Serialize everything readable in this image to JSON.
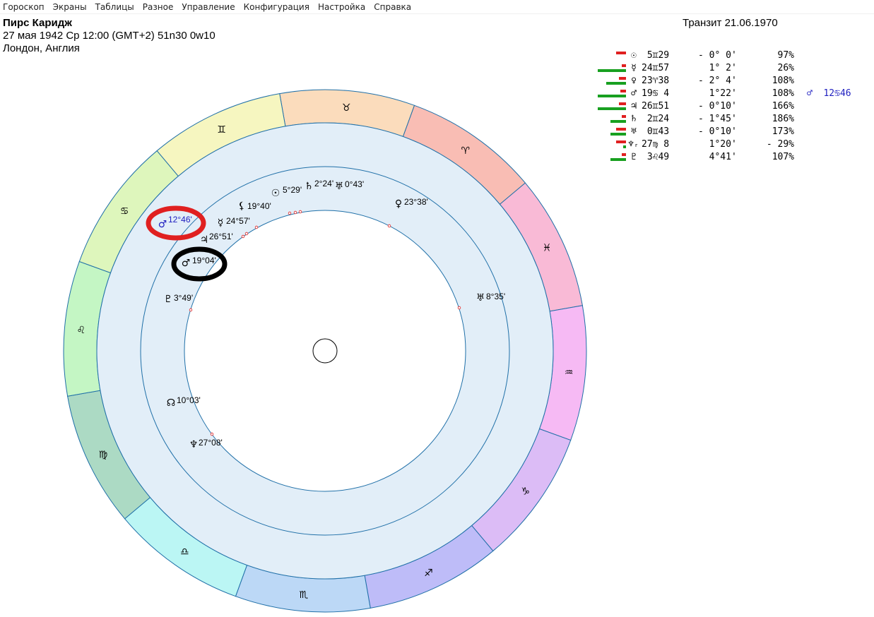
{
  "menu": [
    "Гороскоп",
    "Экраны",
    "Таблицы",
    "Разное",
    "Управление",
    "Конфигурация",
    "Настройка",
    "Справка"
  ],
  "header": {
    "name": "Пирс Каридж",
    "date_line": "27 мая 1942  Ср  12:00 (GMT+2) 51n30  0w10",
    "place": "Лондон, Англия"
  },
  "transit_title": "Транзит 21.06.1970",
  "planet_table": [
    {
      "glyph": "☉",
      "pos": " 5♊29",
      "aspect": "- 0° 0'",
      "pct": "97%",
      "red": 14,
      "green": 0,
      "extra": ""
    },
    {
      "glyph": "☿",
      "pos": "24♊57",
      "aspect": "  1° 2'",
      "pct": "26%",
      "red": 6,
      "green": 40,
      "extra": ""
    },
    {
      "glyph": "♀",
      "pos": "23♈38",
      "aspect": "- 2° 4'",
      "pct": "108%",
      "red": 10,
      "green": 28,
      "extra": ""
    },
    {
      "glyph": "♂",
      "pos": "19♋ 4",
      "aspect": "  1°22'",
      "pct": "108%",
      "red": 8,
      "green": 40,
      "extra": "♂  12♋46"
    },
    {
      "glyph": "♃",
      "pos": "26♊51",
      "aspect": "- 0°10'",
      "pct": "166%",
      "red": 10,
      "green": 40,
      "extra": ""
    },
    {
      "glyph": "♄",
      "pos": " 2♊24",
      "aspect": "- 1°45'",
      "pct": "186%",
      "red": 6,
      "green": 22,
      "extra": ""
    },
    {
      "glyph": "♅",
      "pos": " 0♊43",
      "aspect": "- 0°10'",
      "pct": "173%",
      "red": 14,
      "green": 22,
      "extra": ""
    },
    {
      "glyph": "♆ᵣ",
      "pos": "27♍ 8",
      "aspect": "  1°20'",
      "pct": "- 29%",
      "red": 14,
      "green": 4,
      "extra": ""
    },
    {
      "glyph": "♇",
      "pos": " 3♌49",
      "aspect": "  4°41'",
      "pct": "107%",
      "red": 6,
      "green": 22,
      "extra": ""
    }
  ],
  "zodiac": [
    {
      "sign": "♉",
      "color": "#fbdcbc"
    },
    {
      "sign": "♈",
      "color": "#f9bdb4"
    },
    {
      "sign": "♓",
      "color": "#f9bad6"
    },
    {
      "sign": "♒",
      "color": "#f6baf4"
    },
    {
      "sign": "♑",
      "color": "#dcbcf6"
    },
    {
      "sign": "♐",
      "color": "#bebcf8"
    },
    {
      "sign": "♏",
      "color": "#bcd8f6"
    },
    {
      "sign": "♎",
      "color": "#bbf6f4"
    },
    {
      "sign": "♍",
      "color": "#acdac4"
    },
    {
      "sign": "♌",
      "color": "#c4f6c4"
    },
    {
      "sign": "♋",
      "color": "#def6bc"
    },
    {
      "sign": "♊",
      "color": "#f6f6c0"
    }
  ],
  "wheel_planets": [
    {
      "glyph": "☉",
      "label": "5°29'"
    },
    {
      "glyph": "♄",
      "label": "2°24'"
    },
    {
      "glyph": "♅",
      "label": "0°43'"
    },
    {
      "glyph": "♀",
      "label": "23°38'"
    },
    {
      "glyph": "⚸",
      "label": "19°40'"
    },
    {
      "glyph": "☿",
      "label": "24°57'"
    },
    {
      "glyph": "♃",
      "label": "26°51'"
    },
    {
      "glyph": "♂",
      "label": "19°04'"
    },
    {
      "glyph": "♇",
      "label": "3°49'"
    },
    {
      "glyph": "♅",
      "label": "8°35'"
    },
    {
      "glyph": "☊",
      "label": "10°03'"
    },
    {
      "glyph": "♆",
      "label": "27°08'"
    }
  ],
  "transit_mars": {
    "glyph": "♂",
    "label": "12°46'"
  },
  "colors": {
    "ring_stroke": "#2070a8",
    "inner_fill": "#e2eef8",
    "red_circle": "#e02020",
    "black_circle": "#000000",
    "transit_color": "#2020c0"
  }
}
